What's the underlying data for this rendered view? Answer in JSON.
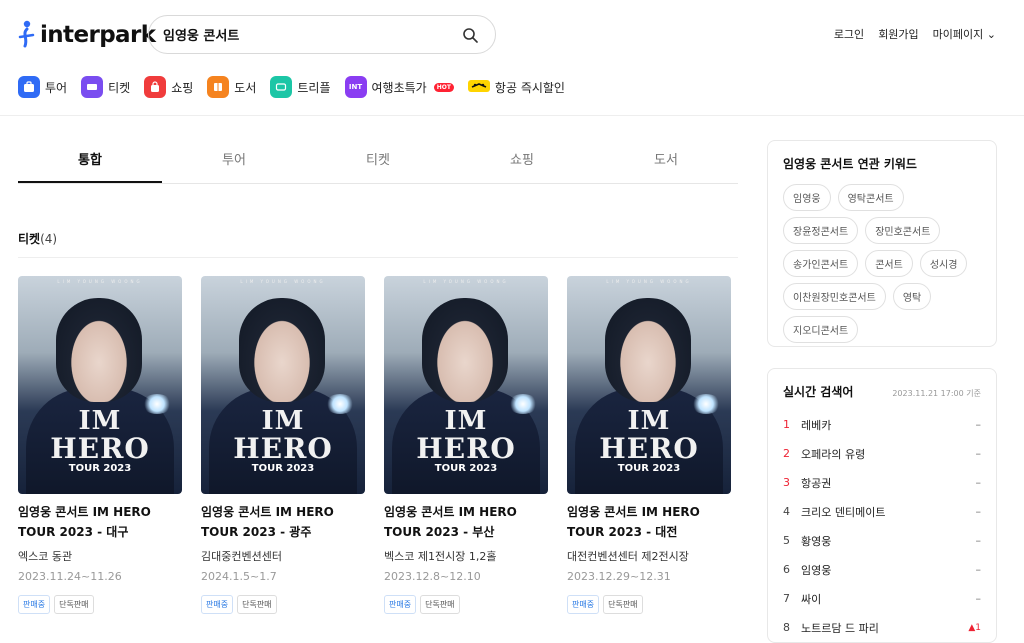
{
  "header": {
    "logo_text": "interpark",
    "search_value": "임영웅 콘서트",
    "util": [
      "로그인",
      "회원가입",
      "마이페이지"
    ],
    "categories": [
      {
        "label": "투어",
        "color": "#2f6bf5",
        "icon": "suitcase-icon"
      },
      {
        "label": "티켓",
        "color": "#7a4df0",
        "icon": "ticket-icon"
      },
      {
        "label": "쇼핑",
        "color": "#f03c3c",
        "icon": "bag-icon"
      },
      {
        "label": "도서",
        "color": "#f5831f",
        "icon": "book-icon"
      },
      {
        "label": "트리플",
        "color": "#1cc6a6",
        "icon": "triple-icon"
      },
      {
        "label": "여행초특가",
        "color": "#8a3df2",
        "icon": "int-icon",
        "badge": "HOT",
        "icon_text": "INT"
      },
      {
        "label": "항공 즉시할인",
        "color": "#ffd400",
        "icon": "plane-deal-icon"
      }
    ]
  },
  "tabs": [
    "통합",
    "투어",
    "티켓",
    "쇼핑",
    "도서"
  ],
  "section": {
    "title": "티켓",
    "count": "(4)"
  },
  "poster": {
    "line1": "IM",
    "line2": "HERO",
    "line3": "TOUR 2023",
    "top": "LIM YOUNG WOONG"
  },
  "cards": [
    {
      "name": "임영웅 콘서트 IM HERO TOUR 2023 - 대구",
      "venue": "엑스코 동관",
      "date": "2023.11.24~11.26",
      "badges": [
        "판매중",
        "단독판매"
      ]
    },
    {
      "name": "임영웅 콘서트 IM HERO TOUR 2023 - 광주",
      "venue": "김대중컨벤션센터",
      "date": "2024.1.5~1.7",
      "badges": [
        "판매중",
        "단독판매"
      ]
    },
    {
      "name": "임영웅 콘서트 IM HERO TOUR 2023 - 부산",
      "venue": "벡스코 제1전시장 1,2홀",
      "date": "2023.12.8~12.10",
      "badges": [
        "판매중",
        "단독판매"
      ]
    },
    {
      "name": "임영웅 콘서트 IM HERO TOUR 2023 - 대전",
      "venue": "대전컨벤션센터 제2전시장",
      "date": "2023.12.29~12.31",
      "badges": [
        "판매중",
        "단독판매"
      ]
    }
  ],
  "keywords": {
    "title": "임영웅 콘서트 연관 키워드",
    "items": [
      "임영웅",
      "영탁콘서트",
      "장윤정콘서트",
      "장민호콘서트",
      "송가인콘서트",
      "콘서트",
      "성시경",
      "이찬원장민호콘서트",
      "영탁",
      "지오디콘서트"
    ]
  },
  "realtime": {
    "title": "실시간 검색어",
    "time": "2023.11.21 17:00 기준",
    "items": [
      {
        "rank": "1",
        "kw": "레베카",
        "st": "–"
      },
      {
        "rank": "2",
        "kw": "오페라의 유령",
        "st": "–"
      },
      {
        "rank": "3",
        "kw": "항공권",
        "st": "–"
      },
      {
        "rank": "4",
        "kw": "크리오 덴티메이트",
        "st": "–"
      },
      {
        "rank": "5",
        "kw": "황영웅",
        "st": "–"
      },
      {
        "rank": "6",
        "kw": "임영웅",
        "st": "–"
      },
      {
        "rank": "7",
        "kw": "싸이",
        "st": "–"
      },
      {
        "rank": "8",
        "kw": "노트르담 드 파리",
        "st": "▲1"
      }
    ]
  }
}
